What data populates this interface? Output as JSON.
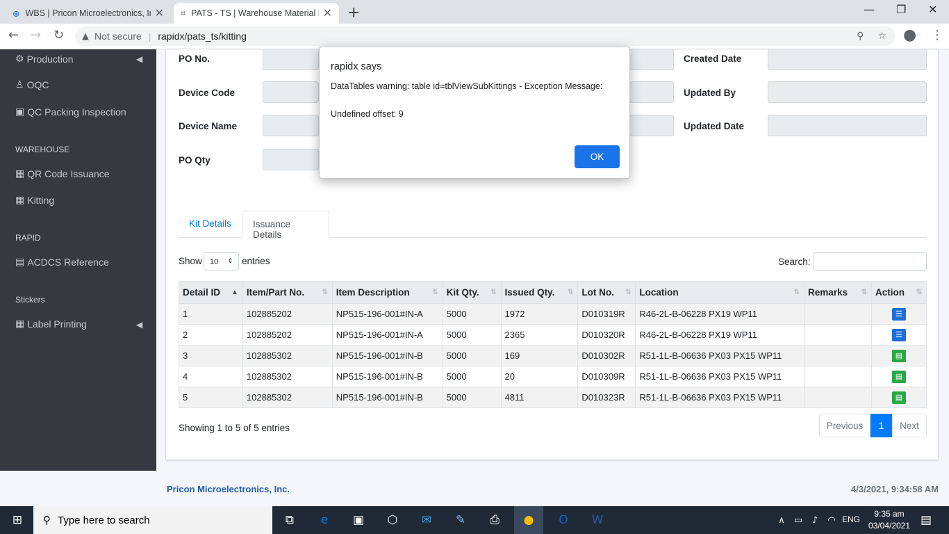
{
  "browser": {
    "tabs": [
      {
        "title": "WBS | Pricon Microelectronics, Inc.",
        "active": false
      },
      {
        "title": "PATS - TS | Warehouse Material Kitting",
        "active": true
      }
    ],
    "address": {
      "security": "Not secure",
      "url": "rapidx/pats_ts/kitting"
    }
  },
  "sidebar": {
    "items": [
      {
        "label": "Production"
      },
      {
        "label": "OQC"
      },
      {
        "label": "QC Packing Inspection"
      }
    ],
    "warehouse_header": "WAREHOUSE",
    "warehouse_items": [
      {
        "label": "QR Code Issuance"
      },
      {
        "label": "Kitting"
      }
    ],
    "rapid_header": "RAPID",
    "rapid_items": [
      {
        "label": "ACDCS Reference"
      }
    ],
    "stickers_header": "Stickers",
    "sticker_items": [
      {
        "label": "Label Printing"
      }
    ]
  },
  "form": {
    "po_no": "PO No.",
    "device_code": "Device Code",
    "device_name": "Device Name",
    "po_qty": "PO Qty",
    "created_date": "Created Date",
    "updated_by": "Updated By",
    "updated_date": "Updated Date"
  },
  "tabs": {
    "kit": "Kit Details",
    "issuance": "Issuance Details"
  },
  "table_controls": {
    "show": "Show",
    "entries_value": "10",
    "entries": "entries",
    "search": "Search:",
    "info": "Showing 1 to 5 of 5 entries",
    "previous": "Previous",
    "page": "1",
    "next": "Next"
  },
  "table": {
    "headers": [
      "Detail ID",
      "Item/Part No.",
      "Item Description",
      "Kit Qty.",
      "Issued Qty.",
      "Lot No.",
      "Location",
      "Remarks",
      "Action"
    ],
    "rows": [
      {
        "id": "1",
        "part": "102885202",
        "desc": "NP515-196-001#IN-A",
        "kit": "5000",
        "issued": "1972",
        "lot": "D010319R",
        "loc": "R46-2L-B-06228 PX19 WP11",
        "remarks": "",
        "action": "list-icon"
      },
      {
        "id": "2",
        "part": "102885202",
        "desc": "NP515-196-001#IN-A",
        "kit": "5000",
        "issued": "2365",
        "lot": "D010320R",
        "loc": "R46-2L-B-06228 PX19 WP11",
        "remarks": "",
        "action": "list-icon"
      },
      {
        "id": "3",
        "part": "102885302",
        "desc": "NP515-196-001#IN-B",
        "kit": "5000",
        "issued": "169",
        "lot": "D010302R",
        "loc": "R51-1L-B-06636 PX03 PX15 WP11",
        "remarks": "",
        "action": "document-icon"
      },
      {
        "id": "4",
        "part": "102885302",
        "desc": "NP515-196-001#IN-B",
        "kit": "5000",
        "issued": "20",
        "lot": "D010309R",
        "loc": "R51-1L-B-06636 PX03 PX15 WP11",
        "remarks": "",
        "action": "document-icon"
      },
      {
        "id": "5",
        "part": "102885302",
        "desc": "NP515-196-001#IN-B",
        "kit": "5000",
        "issued": "4811",
        "lot": "D010323R",
        "loc": "R51-1L-B-06636 PX03 PX15 WP11",
        "remarks": "",
        "action": "document-icon"
      }
    ]
  },
  "dialog": {
    "title": "rapidx says",
    "message": "DataTables warning: table id=tblViewSubKittings - Exception Message:",
    "detail": "Undefined offset: 9",
    "ok": "OK"
  },
  "footer": {
    "company": "Pricon Microelectronics, Inc.",
    "timestamp": "4/3/2021, 9:34:58 AM"
  },
  "taskbar": {
    "search_placeholder": "Type here to search",
    "lang": "ENG",
    "time": "9:35 am",
    "date": "03/04/2021"
  },
  "colors": {
    "sidebar": "#343a40",
    "accent": "#007bff",
    "ok_button": "#1a73e8",
    "action_blue": "#1e6ed8",
    "action_green": "#28a745"
  }
}
